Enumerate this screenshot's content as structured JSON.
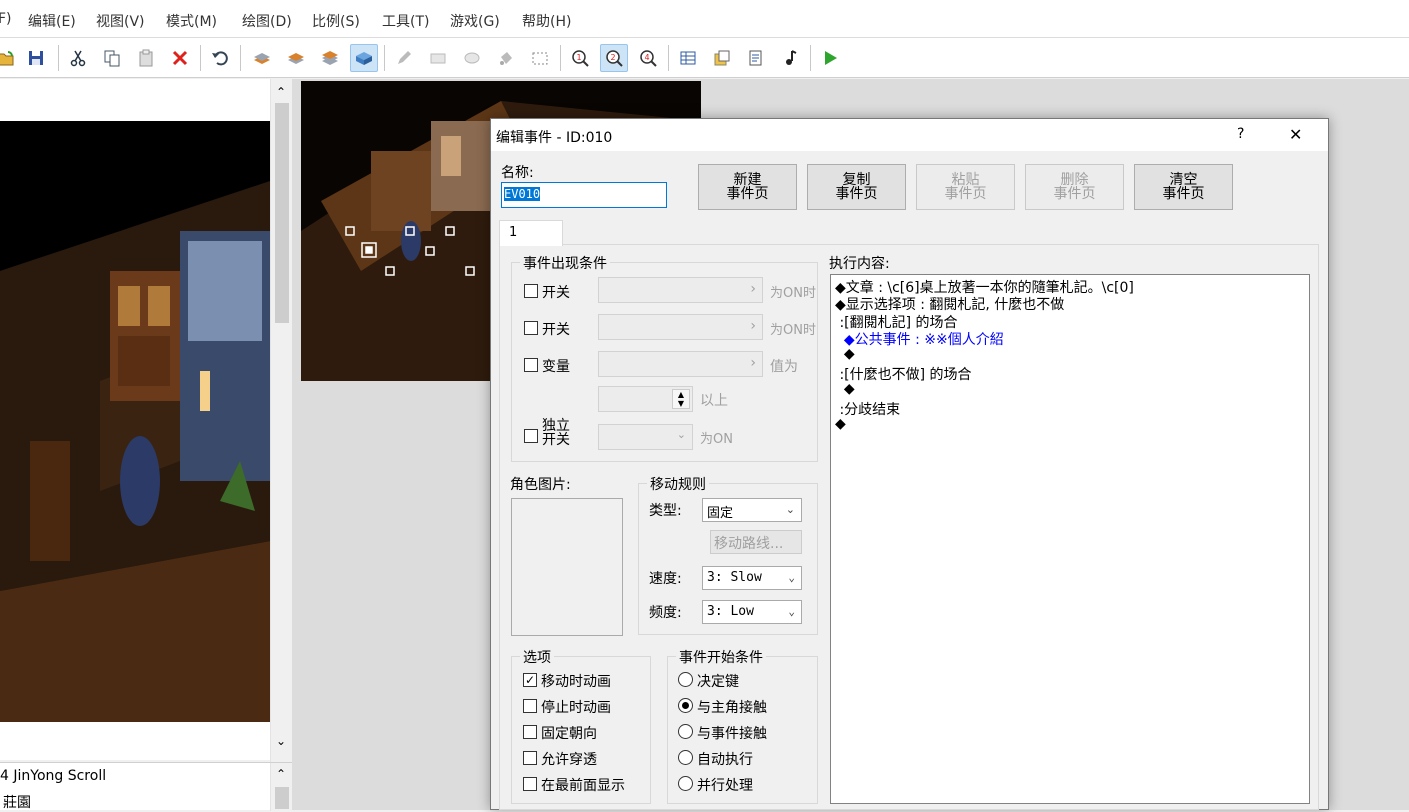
{
  "menu": [
    "编辑(E)",
    "视图(V)",
    "模式(M)",
    "绘图(D)",
    "比例(S)",
    "工具(T)",
    "游戏(G)",
    "帮助(H)"
  ],
  "menu_partial": "F)",
  "maplist": [
    "4 JinYong Scroll",
    "莊園"
  ],
  "dialog": {
    "title": "编辑事件 - ID:010",
    "help": "?",
    "close": "✕",
    "name_label": "名称:",
    "name_value": "EV010",
    "buttons": [
      {
        "l1": "新建",
        "l2": "事件页"
      },
      {
        "l1": "复制",
        "l2": "事件页"
      },
      {
        "l1": "粘贴",
        "l2": "事件页"
      },
      {
        "l1": "删除",
        "l2": "事件页"
      },
      {
        "l1": "清空",
        "l2": "事件页"
      }
    ],
    "tab": "1",
    "conditions": {
      "title": "事件出现条件",
      "switch1": "开关",
      "switch1_suffix": "为ON时",
      "switch2": "开关",
      "switch2_suffix": "为ON时",
      "variable": "变量",
      "variable_suffix": "值为",
      "above": "以上",
      "self_switch_1": "独立",
      "self_switch_2": "开关",
      "self_switch_suffix": "为ON"
    },
    "graphic_label": "角色图片:",
    "movement": {
      "title": "移动规则",
      "type_label": "类型:",
      "type_value": "固定",
      "route_button": "移动路线...",
      "speed_label": "速度:",
      "speed_value": "3: Slow",
      "freq_label": "频度:",
      "freq_value": "3: Low"
    },
    "options": {
      "title": "选项",
      "items": [
        {
          "label": "移动时动画",
          "checked": true
        },
        {
          "label": "停止时动画",
          "checked": false
        },
        {
          "label": "固定朝向",
          "checked": false
        },
        {
          "label": "允许穿透",
          "checked": false
        },
        {
          "label": "在最前面显示",
          "checked": false
        }
      ]
    },
    "trigger": {
      "title": "事件开始条件",
      "items": [
        {
          "label": "决定键",
          "selected": false
        },
        {
          "label": "与主角接触",
          "selected": true
        },
        {
          "label": "与事件接触",
          "selected": false
        },
        {
          "label": "自动执行",
          "selected": false
        },
        {
          "label": "并行处理",
          "selected": false
        }
      ]
    },
    "contents_label": "执行内容:",
    "contents": [
      "◆文章 : \\c[6]桌上放著一本你的隨筆札記。\\c[0]",
      "◆显示选择项 : 翻閱札記, 什麼也不做",
      " :[翻閱札記] 的场合",
      "  ◆公共事件 : ※※個人介紹",
      "  ◆",
      " :[什麼也不做] 的场合",
      "  ◆",
      " :分歧结束",
      "◆"
    ]
  }
}
